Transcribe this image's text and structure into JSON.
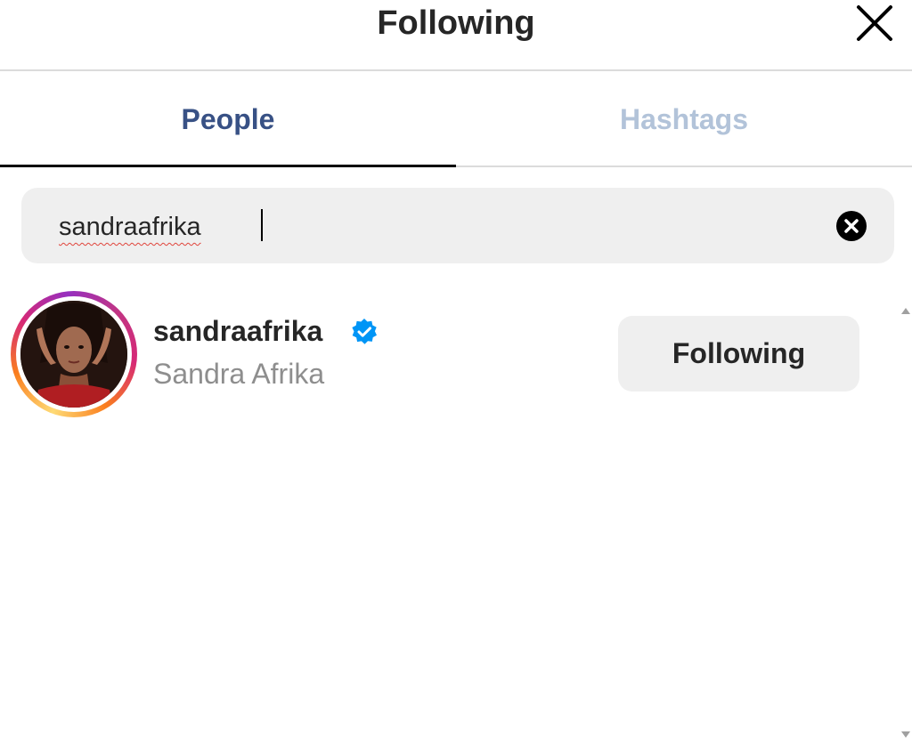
{
  "header": {
    "title": "Following",
    "close_icon": "close-icon"
  },
  "tabs": [
    {
      "label": "People",
      "active": true
    },
    {
      "label": "Hashtags",
      "active": false
    }
  ],
  "search": {
    "value": "sandraafrika",
    "clear_icon": "clear-circle-icon"
  },
  "results": [
    {
      "username": "sandraafrika",
      "verified": true,
      "full_name": "Sandra Afrika",
      "action_label": "Following"
    }
  ],
  "colors": {
    "active_tab": "#385185",
    "inactive_tab": "#b2c3d9",
    "verified_badge": "#0095f6",
    "button_bg": "#efefef",
    "secondary_text": "#8e8e8e"
  }
}
